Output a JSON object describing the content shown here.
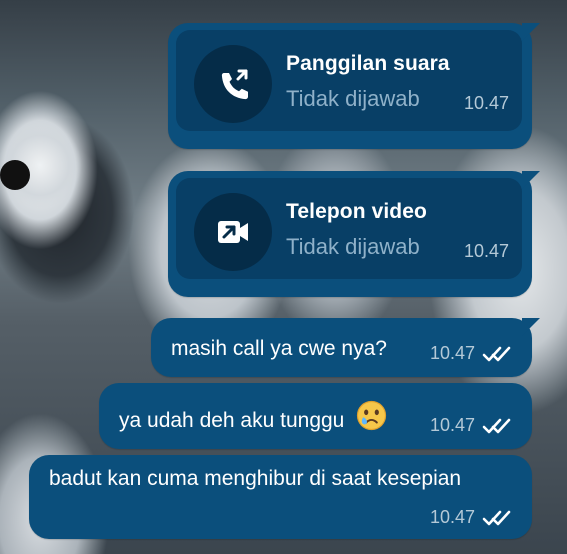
{
  "chat": {
    "calls": [
      {
        "title": "Panggilan suara",
        "status": "Tidak dijawab",
        "time": "10.47",
        "icon": "phone-missed-outgoing-icon"
      },
      {
        "title": "Telepon video",
        "status": "Tidak dijawab",
        "time": "10.47",
        "icon": "video-call-outgoing-icon"
      }
    ],
    "messages": [
      {
        "text": "masih call ya cwe nya?",
        "time": "10.47",
        "status_icon": "double-check-icon"
      },
      {
        "text": "ya udah deh aku tunggu",
        "emoji": "sad-tear-face-emoji",
        "time": "10.47",
        "status_icon": "double-check-icon"
      },
      {
        "text": "badut kan cuma menghibur di saat kesepian",
        "time": "10.47",
        "status_icon": "double-check-icon"
      }
    ]
  },
  "colors": {
    "bubble": "#0b4f7c",
    "card": "#083f66",
    "icon_circle": "#052c48",
    "text": "#ffffff",
    "muted_text": "#8fb1c9",
    "time_text": "#b4c9d7"
  }
}
